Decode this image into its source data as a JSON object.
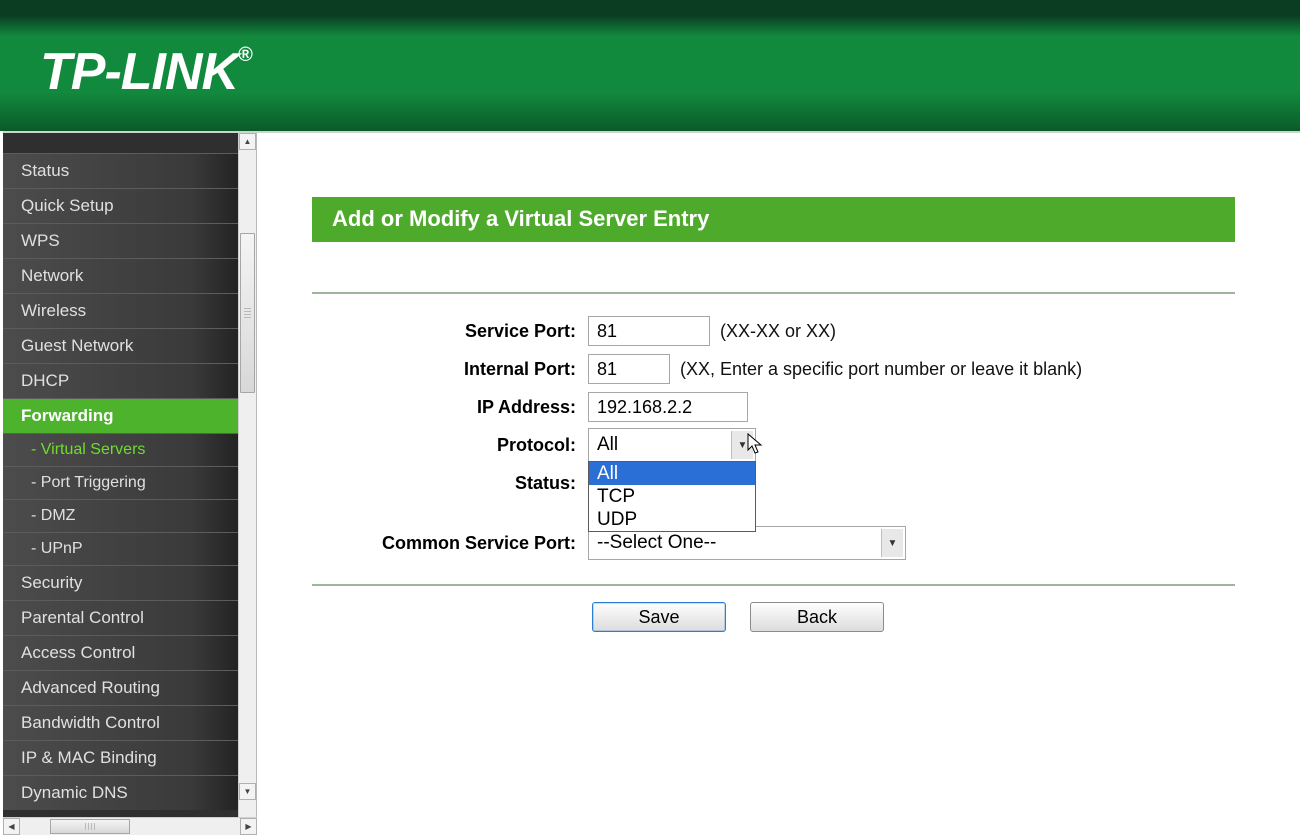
{
  "brand": {
    "name": "TP-LINK",
    "registered": "®"
  },
  "sidebar": {
    "items": [
      {
        "label": "Status",
        "active": false
      },
      {
        "label": "Quick Setup",
        "active": false
      },
      {
        "label": "WPS",
        "active": false
      },
      {
        "label": "Network",
        "active": false
      },
      {
        "label": "Wireless",
        "active": false
      },
      {
        "label": "Guest Network",
        "active": false
      },
      {
        "label": "DHCP",
        "active": false
      },
      {
        "label": "Forwarding",
        "active": true,
        "subitems": [
          {
            "label": "- Virtual Servers",
            "active": true
          },
          {
            "label": "- Port Triggering",
            "active": false
          },
          {
            "label": "- DMZ",
            "active": false
          },
          {
            "label": "- UPnP",
            "active": false
          }
        ]
      },
      {
        "label": "Security",
        "active": false
      },
      {
        "label": "Parental Control",
        "active": false
      },
      {
        "label": "Access Control",
        "active": false
      },
      {
        "label": "Advanced Routing",
        "active": false
      },
      {
        "label": "Bandwidth Control",
        "active": false
      },
      {
        "label": "IP & MAC Binding",
        "active": false
      },
      {
        "label": "Dynamic DNS",
        "active": false
      }
    ]
  },
  "page": {
    "title": "Add or Modify a Virtual Server Entry",
    "labels": {
      "service_port": "Service Port:",
      "internal_port": "Internal Port:",
      "ip_address": "IP Address:",
      "protocol": "Protocol:",
      "status": "Status:",
      "common_service_port": "Common Service Port:"
    },
    "values": {
      "service_port": "81",
      "internal_port": "81",
      "ip_address": "192.168.2.2",
      "protocol_selected": "All",
      "common_service_port_selected": "--Select One--"
    },
    "hints": {
      "service_port": "(XX-XX or XX)",
      "internal_port": "(XX, Enter a specific port number or leave it blank)"
    },
    "protocol_options": [
      "All",
      "TCP",
      "UDP"
    ],
    "buttons": {
      "save": "Save",
      "back": "Back"
    }
  }
}
